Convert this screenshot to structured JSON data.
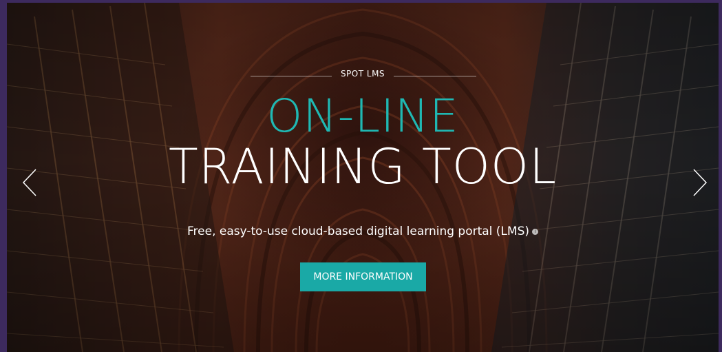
{
  "hero": {
    "eyebrow": "SPOT LMS",
    "headline_line1": "ON-LINE",
    "headline_line2": "TRAINING TOOL",
    "subtitle": "Free, easy-to-use cloud-based digital learning portal (LMS)",
    "info_icon": "info-icon",
    "cta_label": "MORE INFORMATION"
  },
  "carousel": {
    "prev_icon": "chevron-left-icon",
    "next_icon": "chevron-right-icon"
  },
  "colors": {
    "accent": "#1fb8b3",
    "button": "#1aa9a6",
    "frame": "#3d2a5e"
  }
}
